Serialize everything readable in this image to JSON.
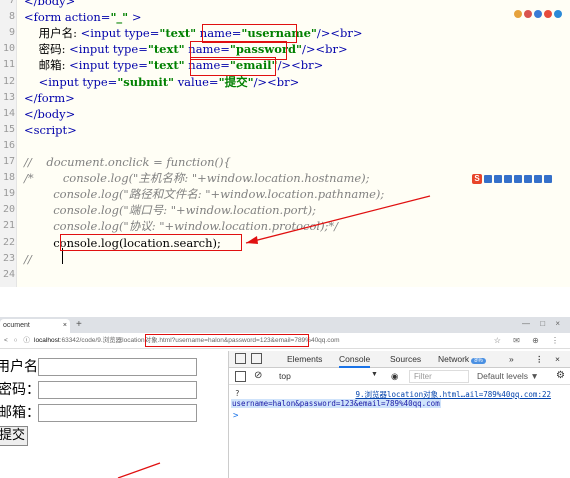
{
  "editor": {
    "lines": [
      {
        "num": "7",
        "segments": [
          {
            "cls": "tag",
            "t": "</body>"
          }
        ]
      },
      {
        "num": "8",
        "segments": [
          {
            "cls": "tag",
            "t": "<form "
          },
          {
            "cls": "attr",
            "t": "action="
          },
          {
            "cls": "str",
            "t": "\"_\""
          },
          {
            "cls": "tag",
            "t": " >"
          }
        ]
      },
      {
        "num": "9",
        "segments": [
          {
            "cls": "txt",
            "t": "    用户名: "
          },
          {
            "cls": "tag",
            "t": "<input "
          },
          {
            "cls": "attr",
            "t": "type="
          },
          {
            "cls": "str",
            "t": "\"text\""
          },
          {
            "cls": "txt",
            "t": " "
          },
          {
            "cls": "attr",
            "t": "name="
          },
          {
            "cls": "str",
            "t": "\"username\""
          },
          {
            "cls": "tag",
            "t": "/><br>"
          }
        ]
      },
      {
        "num": "10",
        "segments": [
          {
            "cls": "txt",
            "t": "    密码: "
          },
          {
            "cls": "tag",
            "t": "<input "
          },
          {
            "cls": "attr",
            "t": "type="
          },
          {
            "cls": "str",
            "t": "\"text\""
          },
          {
            "cls": "txt",
            "t": " "
          },
          {
            "cls": "attr",
            "t": "name="
          },
          {
            "cls": "str",
            "t": "\"password\""
          },
          {
            "cls": "tag",
            "t": "/><br>"
          }
        ]
      },
      {
        "num": "11",
        "segments": [
          {
            "cls": "txt",
            "t": "    邮箱: "
          },
          {
            "cls": "tag",
            "t": "<input "
          },
          {
            "cls": "attr",
            "t": "type="
          },
          {
            "cls": "str",
            "t": "\"text\""
          },
          {
            "cls": "txt",
            "t": " "
          },
          {
            "cls": "attr",
            "t": "name="
          },
          {
            "cls": "str",
            "t": "\"email\""
          },
          {
            "cls": "tag",
            "t": "/><br>"
          }
        ]
      },
      {
        "num": "12",
        "segments": [
          {
            "cls": "tag",
            "t": "    <input "
          },
          {
            "cls": "attr",
            "t": "type="
          },
          {
            "cls": "str",
            "t": "\"submit\""
          },
          {
            "cls": "txt",
            "t": " "
          },
          {
            "cls": "attr",
            "t": "value="
          },
          {
            "cls": "str",
            "t": "\"提交\""
          },
          {
            "cls": "tag",
            "t": "/><br>"
          }
        ]
      },
      {
        "num": "13",
        "segments": [
          {
            "cls": "tag",
            "t": "</form>"
          }
        ]
      },
      {
        "num": "14",
        "segments": [
          {
            "cls": "tag",
            "t": "</body>"
          }
        ]
      },
      {
        "num": "15",
        "segments": [
          {
            "cls": "tag",
            "t": "<script>"
          }
        ]
      },
      {
        "num": "16",
        "segments": []
      },
      {
        "num": "17",
        "segments": [
          {
            "cls": "cmt",
            "t": "//    document.onclick = function(){"
          }
        ]
      },
      {
        "num": "18",
        "segments": [
          {
            "cls": "cmt",
            "t": "/*        console.log(\"主机名称: \"+window.location.hostname);"
          }
        ]
      },
      {
        "num": "19",
        "segments": [
          {
            "cls": "cmt",
            "t": "        console.log(\"路径和文件名: \"+window.location.pathname);"
          }
        ]
      },
      {
        "num": "20",
        "segments": [
          {
            "cls": "cmt",
            "t": "        console.log(\"端口号: \"+window.location.port);"
          }
        ]
      },
      {
        "num": "21",
        "segments": [
          {
            "cls": "cmt",
            "t": "        console.log(\"协议: \"+window.location.protocol);*/"
          }
        ]
      },
      {
        "num": "22",
        "segments": [
          {
            "cls": "jsv",
            "t": "        console.log(location.search);"
          }
        ]
      },
      {
        "num": "23",
        "segments": [
          {
            "cls": "cmt",
            "t": "//"
          }
        ]
      },
      {
        "num": "24",
        "segments": []
      }
    ]
  },
  "browser": {
    "tab_title": "ocument",
    "tab_close": "×",
    "new_tab": "+",
    "window_controls": "— □ ×",
    "nav_icons": "< ○ ⓘ",
    "url_host": "localhost",
    "url_rest": ":63342/code/9.浏览器location对象.html?username=halon&password=123&email=789%40qq.com",
    "addr_right_icons": "☆ ✉ ⊕ ⋮",
    "form": {
      "username_label": "用户名:",
      "password_label": "密码：",
      "email_label": "邮箱：",
      "submit_label": "提交"
    },
    "devtools": {
      "tabs": [
        "Elements",
        "Console",
        "Sources",
        "Network"
      ],
      "active_tab": "Console",
      "network_badge": "8%",
      "more": "»",
      "menu": "⋮",
      "close": "×",
      "context": "top",
      "filter_placeholder": "Filter",
      "levels": "Default levels ▼",
      "log_prefix": "?",
      "log_source": "9.浏览器location对象.html…ail=789%40qq.com:22",
      "log_text": "username=halon&password=123&email=789%40qq.com",
      "prompt": ">"
    }
  },
  "colors": {
    "annotation_red": "#e01010",
    "accent_blue": "#1a73e8"
  }
}
